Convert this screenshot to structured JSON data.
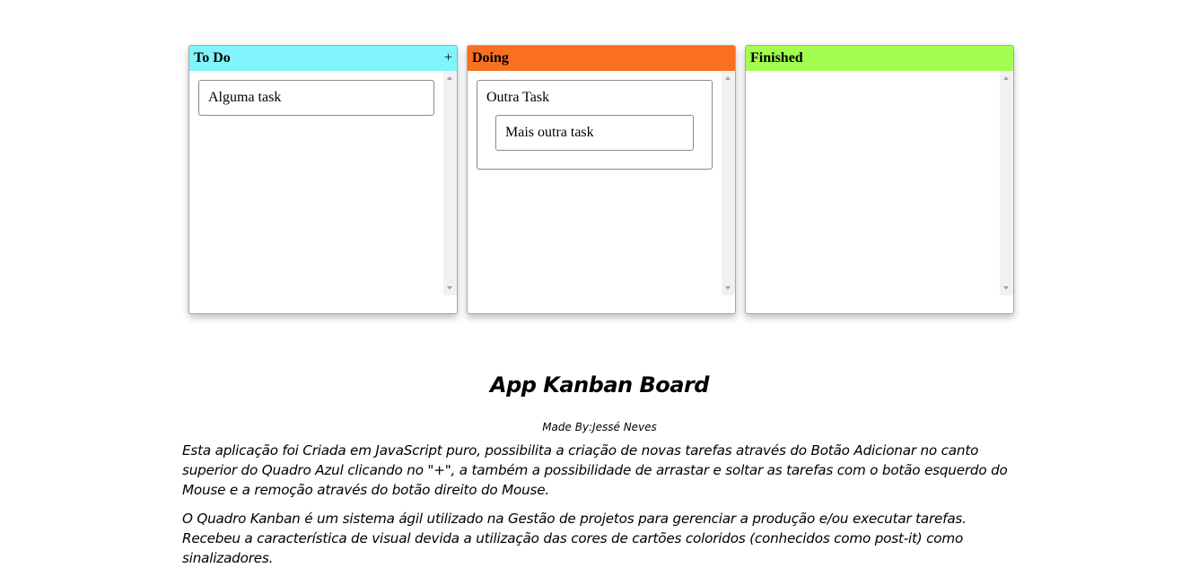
{
  "boards": [
    {
      "title": "To Do",
      "color": "#80f5fb",
      "add_label": "+",
      "tasks": [
        "Alguma task"
      ]
    },
    {
      "title": "Doing",
      "color": "#f97020",
      "tasks": [
        "Outra Task",
        "Mais outra task"
      ]
    },
    {
      "title": "Finished",
      "color": "#a2fe4f",
      "tasks": []
    }
  ],
  "footer": {
    "title": "App Kanban Board",
    "author": "Made By:Jessé Neves",
    "paragraph1": "Esta aplicação foi Criada em JavaScript puro, possibilita a criação de novas tarefas através do Botão Adicionar no canto superior do Quadro Azul clicando no \"+\", a também a possibilidade de arrastar e soltar as tarefas com o botão esquerdo do Mouse e a remoção através do botão direito do Mouse.",
    "paragraph2": "O Quadro Kanban é um sistema ágil utilizado na Gestão de projetos para gerenciar a produção e/ou executar tarefas. Recebeu a característica de visual devida a utilização das cores de cartões coloridos (conhecidos como post-it) como sinalizadores."
  }
}
